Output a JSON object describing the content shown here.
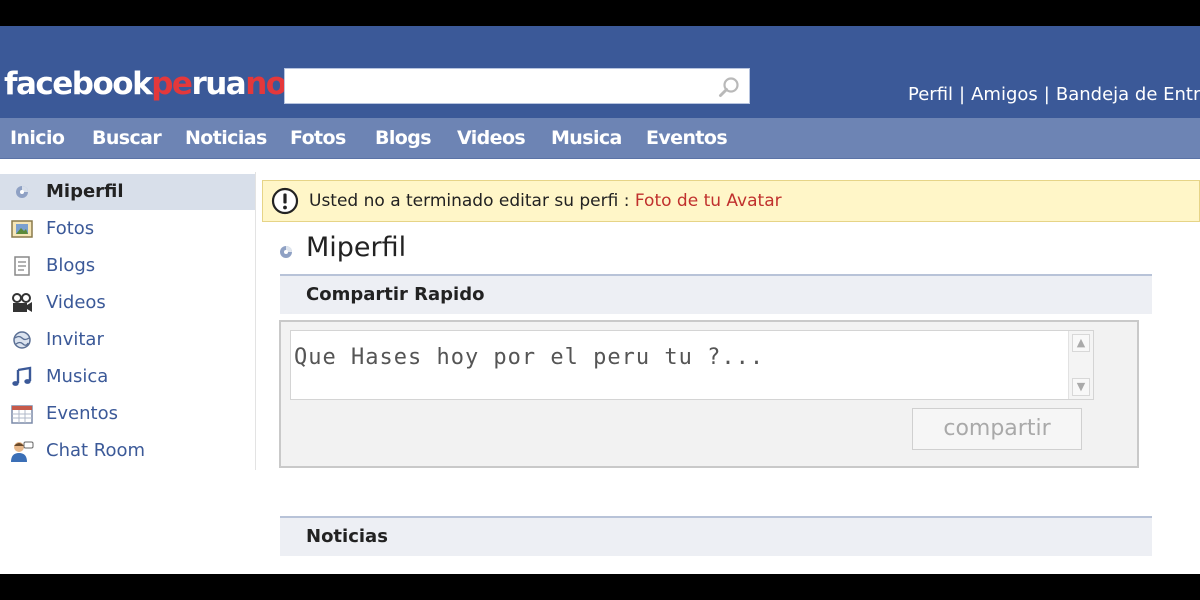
{
  "header": {
    "logo": {
      "part1": "facebook",
      "part2": "pe",
      "part3": "rua",
      "part4": "no"
    },
    "search": {
      "value": "",
      "placeholder": ""
    },
    "links": {
      "perfil": "Perfil",
      "amigos": "Amigos",
      "bandeja": "Bandeja de Entr",
      "separator": "|"
    }
  },
  "nav": {
    "items": [
      "Inicio",
      "Buscar",
      "Noticias",
      "Fotos",
      "Blogs",
      "Videos",
      "Musica",
      "Eventos"
    ]
  },
  "sidebar": {
    "items": [
      {
        "label": "Miperfil",
        "icon": "profile-icon",
        "active": true
      },
      {
        "label": "Fotos",
        "icon": "photos-icon"
      },
      {
        "label": "Blogs",
        "icon": "blogs-icon"
      },
      {
        "label": "Videos",
        "icon": "videos-icon"
      },
      {
        "label": "Invitar",
        "icon": "invite-icon"
      },
      {
        "label": "Musica",
        "icon": "music-icon"
      },
      {
        "label": "Eventos",
        "icon": "events-icon"
      },
      {
        "label": "Chat Room",
        "icon": "chat-room-icon"
      }
    ]
  },
  "alert": {
    "text": "Usted no a terminado editar su perfi : ",
    "link": "Foto de tu Avatar",
    "icon": "warning-icon"
  },
  "main": {
    "title": "Miperfil",
    "share": {
      "header": "Compartir Rapido",
      "text": "Que Hases hoy por el peru tu ?...",
      "button": "compartir"
    },
    "news": {
      "header": "Noticias"
    }
  },
  "colors": {
    "brand_blue": "#3b5998",
    "nav_blue": "#6d84b4",
    "logo_red": "#e4383b",
    "alert_bg": "#fff6c8",
    "alert_link": "#c0302d"
  }
}
